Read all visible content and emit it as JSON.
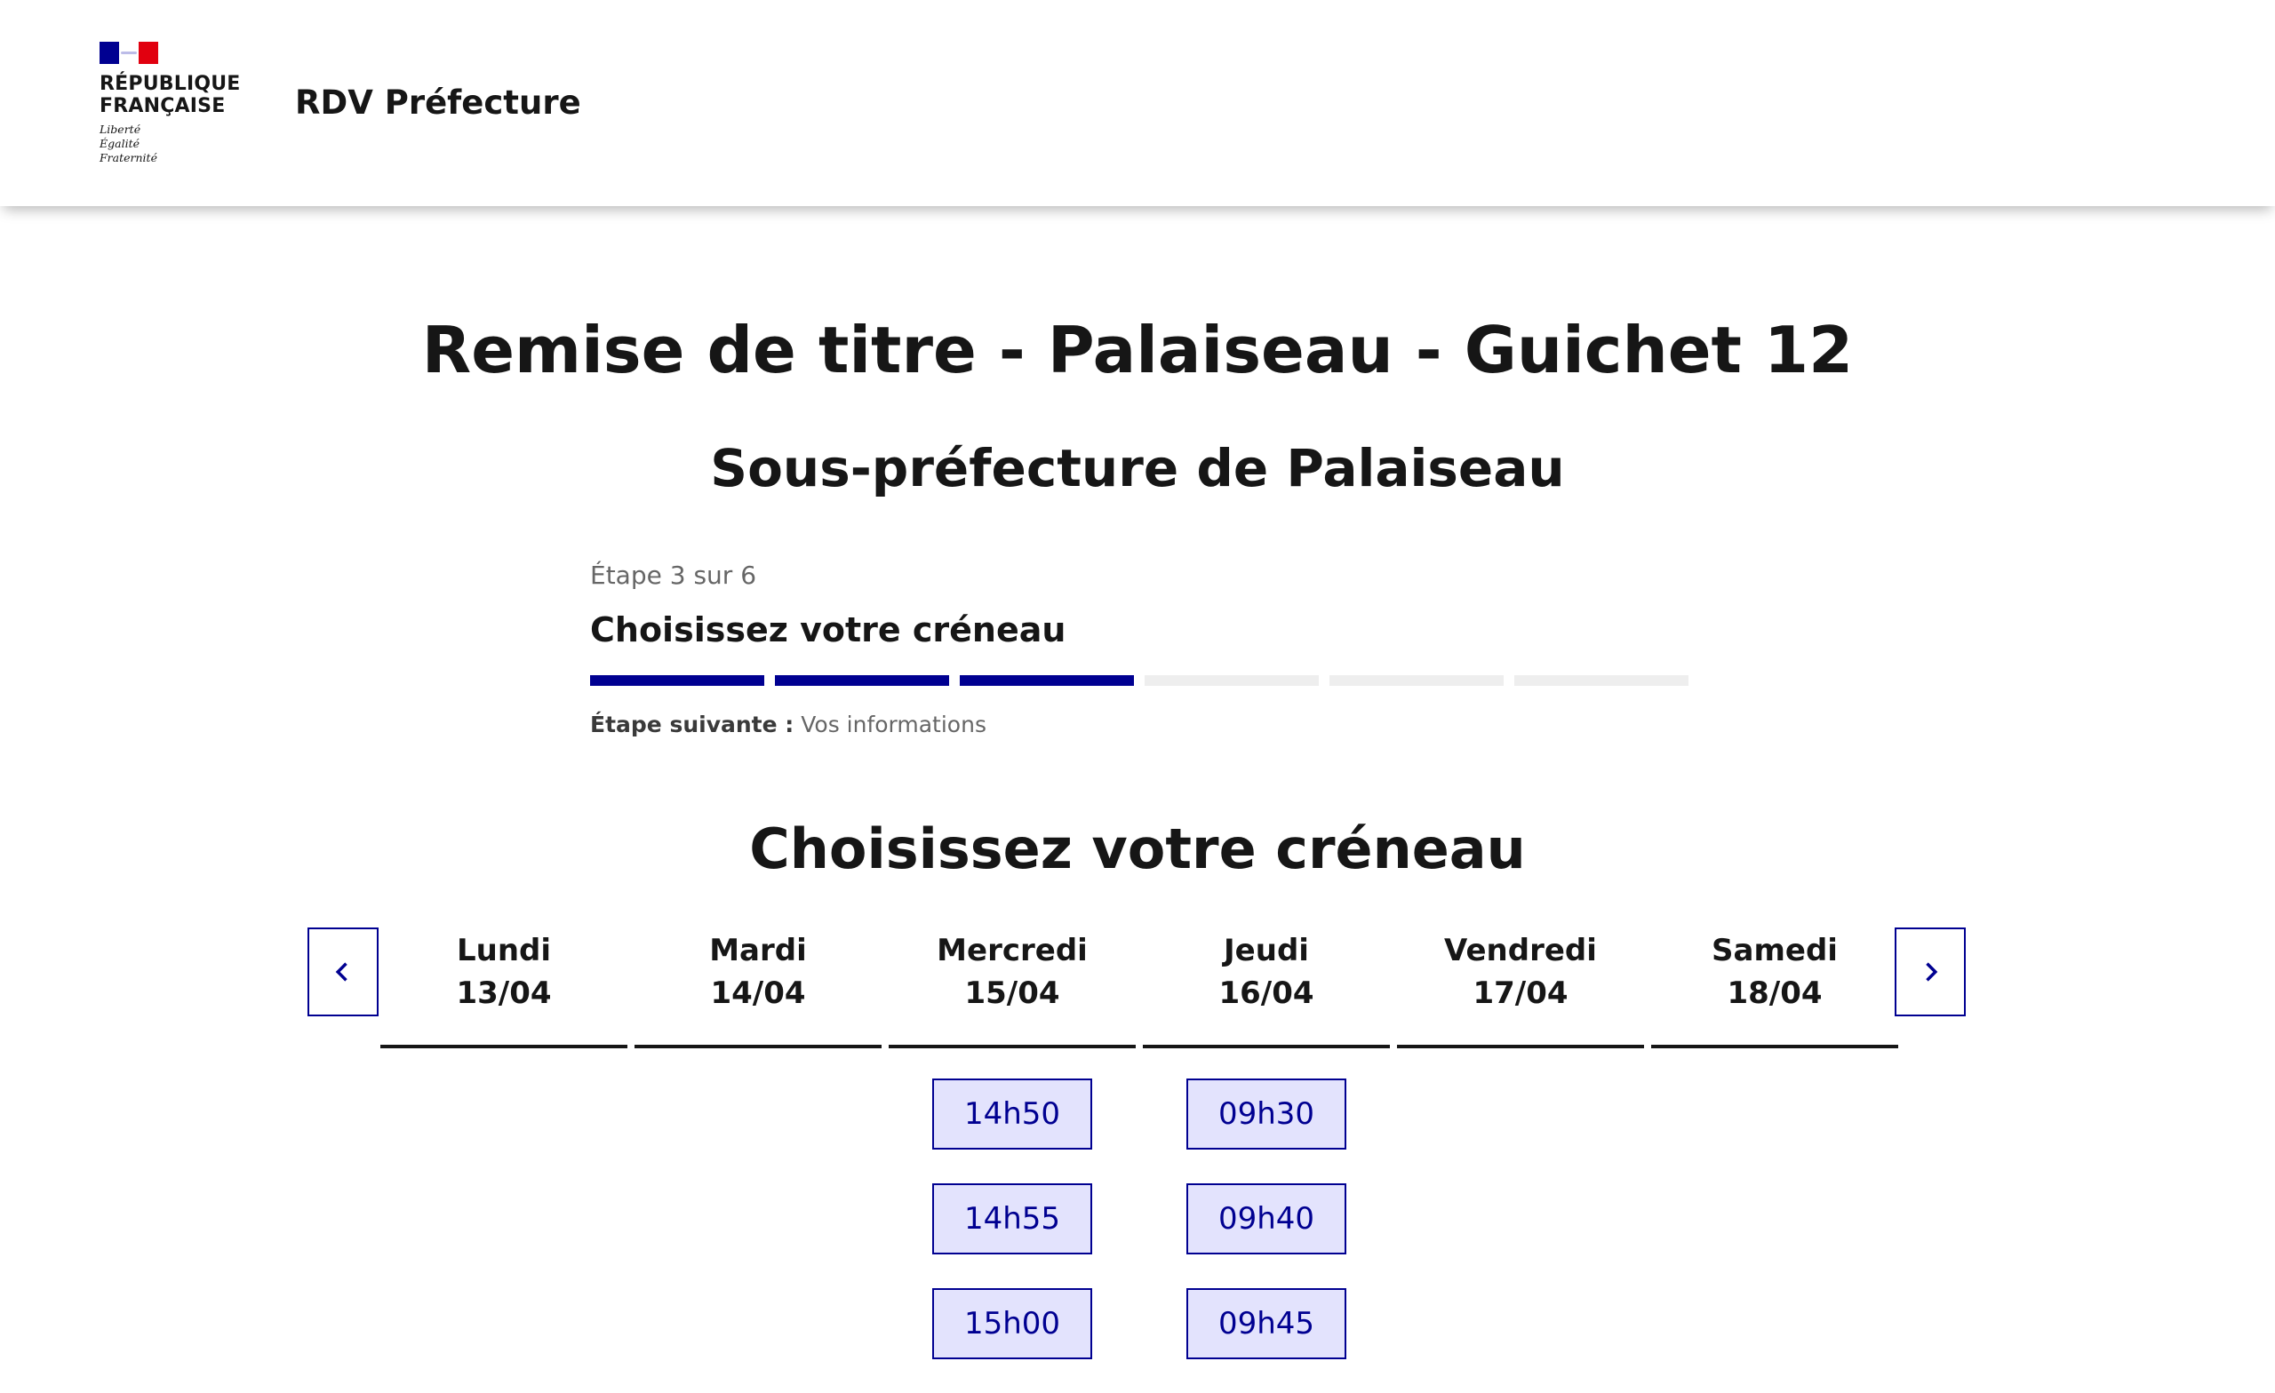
{
  "header": {
    "logo": {
      "line1": "RÉPUBLIQUE",
      "line2": "FRANÇAISE",
      "motto": [
        "Liberté",
        "Égalité",
        "Fraternité"
      ]
    },
    "service_title": "RDV Préfecture"
  },
  "page": {
    "title": "Remise de titre - Palaiseau - Guichet 12",
    "subtitle": "Sous-préfecture de Palaiseau"
  },
  "stepper": {
    "state": "Étape 3 sur 6",
    "title": "Choisissez votre créneau",
    "current_step": 3,
    "total_steps": 6,
    "next_label": "Étape suivante :",
    "next_value": "Vos informations"
  },
  "calendar": {
    "title": "Choisissez votre créneau",
    "prev_icon": "chevron-left-icon",
    "next_icon": "chevron-right-icon",
    "days": [
      {
        "name": "Lundi",
        "date": "13/04",
        "slots": []
      },
      {
        "name": "Mardi",
        "date": "14/04",
        "slots": []
      },
      {
        "name": "Mercredi",
        "date": "15/04",
        "slots": [
          "14h50",
          "14h55",
          "15h00"
        ]
      },
      {
        "name": "Jeudi",
        "date": "16/04",
        "slots": [
          "09h30",
          "09h40",
          "09h45"
        ]
      },
      {
        "name": "Vendredi",
        "date": "17/04",
        "slots": []
      },
      {
        "name": "Samedi",
        "date": "18/04",
        "slots": []
      }
    ]
  },
  "colors": {
    "accent": "#000091",
    "slot_bg": "#e3e3fd",
    "flag_red": "#e1000f",
    "inactive_bar": "#eeeeee"
  }
}
